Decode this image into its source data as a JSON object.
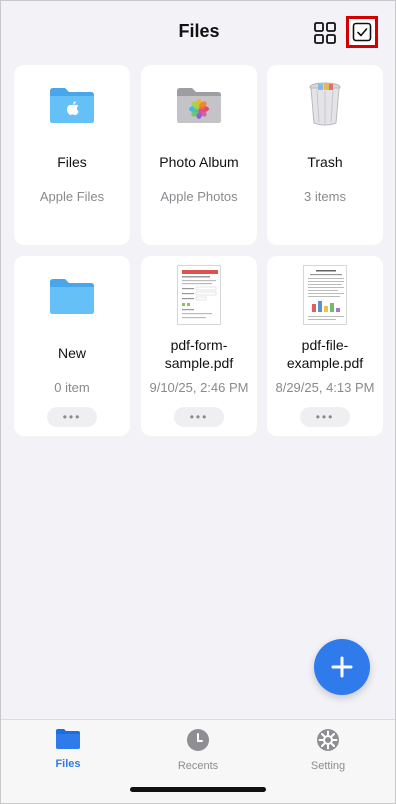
{
  "header": {
    "title": "Files"
  },
  "colors": {
    "accent": "#2f7bec",
    "highlight": "#d40000",
    "secondary_text": "#8a8a8e",
    "folder_blue": "#5ab8f5"
  },
  "cards": [
    {
      "name": "Files",
      "subtitle": "Apple Files",
      "icon": "apple-folder-icon"
    },
    {
      "name": "Photo Album",
      "subtitle": "Apple Photos",
      "icon": "photos-folder-icon"
    },
    {
      "name": "Trash",
      "subtitle": "3 items",
      "icon": "trash-icon"
    },
    {
      "name": "New",
      "subtitle": "0 item",
      "icon": "folder-icon",
      "more": "•••"
    },
    {
      "name": "pdf-form-sample.pdf",
      "subtitle": "9/10/25, 2:46 PM",
      "icon": "pdf-thumbnail-icon",
      "more": "•••"
    },
    {
      "name": "pdf-file-example.pdf",
      "subtitle": "8/29/25, 4:13 PM",
      "icon": "pdf-thumbnail-icon",
      "more": "•••"
    }
  ],
  "fab": {
    "label": "+"
  },
  "tabs": [
    {
      "label": "Files",
      "icon": "folder-icon",
      "selected": true
    },
    {
      "label": "Recents",
      "icon": "clock-icon",
      "selected": false
    },
    {
      "label": "Setting",
      "icon": "gear-icon",
      "selected": false
    }
  ]
}
